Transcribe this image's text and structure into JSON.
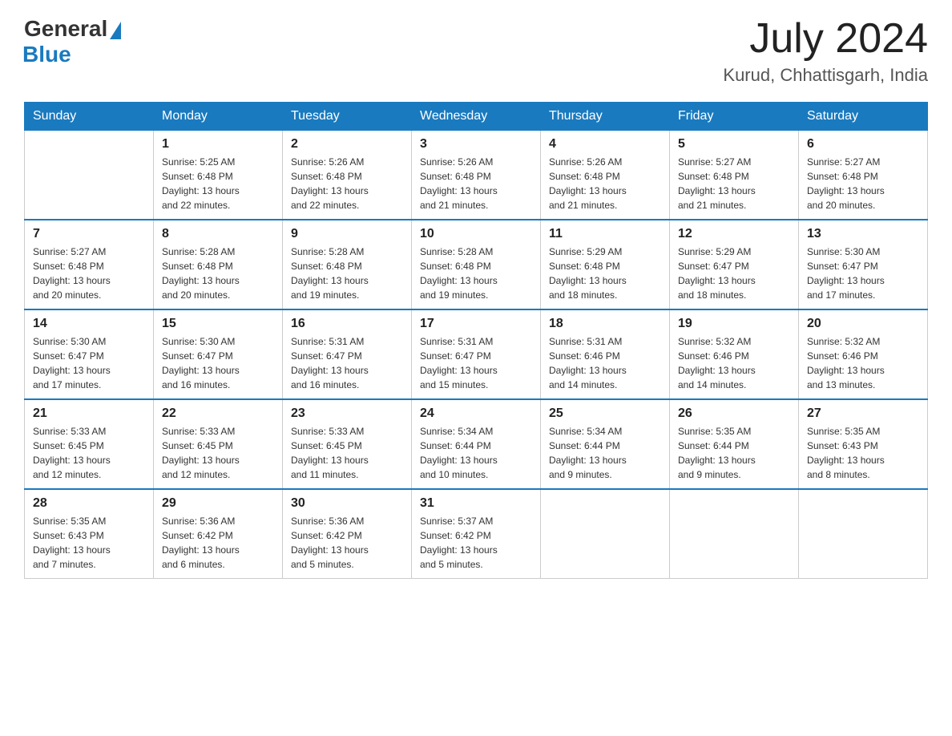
{
  "logo": {
    "general": "General",
    "blue": "Blue"
  },
  "title": {
    "month_year": "July 2024",
    "location": "Kurud, Chhattisgarh, India"
  },
  "header_days": [
    "Sunday",
    "Monday",
    "Tuesday",
    "Wednesday",
    "Thursday",
    "Friday",
    "Saturday"
  ],
  "weeks": [
    [
      {
        "day": "",
        "info": ""
      },
      {
        "day": "1",
        "info": "Sunrise: 5:25 AM\nSunset: 6:48 PM\nDaylight: 13 hours\nand 22 minutes."
      },
      {
        "day": "2",
        "info": "Sunrise: 5:26 AM\nSunset: 6:48 PM\nDaylight: 13 hours\nand 22 minutes."
      },
      {
        "day": "3",
        "info": "Sunrise: 5:26 AM\nSunset: 6:48 PM\nDaylight: 13 hours\nand 21 minutes."
      },
      {
        "day": "4",
        "info": "Sunrise: 5:26 AM\nSunset: 6:48 PM\nDaylight: 13 hours\nand 21 minutes."
      },
      {
        "day": "5",
        "info": "Sunrise: 5:27 AM\nSunset: 6:48 PM\nDaylight: 13 hours\nand 21 minutes."
      },
      {
        "day": "6",
        "info": "Sunrise: 5:27 AM\nSunset: 6:48 PM\nDaylight: 13 hours\nand 20 minutes."
      }
    ],
    [
      {
        "day": "7",
        "info": "Sunrise: 5:27 AM\nSunset: 6:48 PM\nDaylight: 13 hours\nand 20 minutes."
      },
      {
        "day": "8",
        "info": "Sunrise: 5:28 AM\nSunset: 6:48 PM\nDaylight: 13 hours\nand 20 minutes."
      },
      {
        "day": "9",
        "info": "Sunrise: 5:28 AM\nSunset: 6:48 PM\nDaylight: 13 hours\nand 19 minutes."
      },
      {
        "day": "10",
        "info": "Sunrise: 5:28 AM\nSunset: 6:48 PM\nDaylight: 13 hours\nand 19 minutes."
      },
      {
        "day": "11",
        "info": "Sunrise: 5:29 AM\nSunset: 6:48 PM\nDaylight: 13 hours\nand 18 minutes."
      },
      {
        "day": "12",
        "info": "Sunrise: 5:29 AM\nSunset: 6:47 PM\nDaylight: 13 hours\nand 18 minutes."
      },
      {
        "day": "13",
        "info": "Sunrise: 5:30 AM\nSunset: 6:47 PM\nDaylight: 13 hours\nand 17 minutes."
      }
    ],
    [
      {
        "day": "14",
        "info": "Sunrise: 5:30 AM\nSunset: 6:47 PM\nDaylight: 13 hours\nand 17 minutes."
      },
      {
        "day": "15",
        "info": "Sunrise: 5:30 AM\nSunset: 6:47 PM\nDaylight: 13 hours\nand 16 minutes."
      },
      {
        "day": "16",
        "info": "Sunrise: 5:31 AM\nSunset: 6:47 PM\nDaylight: 13 hours\nand 16 minutes."
      },
      {
        "day": "17",
        "info": "Sunrise: 5:31 AM\nSunset: 6:47 PM\nDaylight: 13 hours\nand 15 minutes."
      },
      {
        "day": "18",
        "info": "Sunrise: 5:31 AM\nSunset: 6:46 PM\nDaylight: 13 hours\nand 14 minutes."
      },
      {
        "day": "19",
        "info": "Sunrise: 5:32 AM\nSunset: 6:46 PM\nDaylight: 13 hours\nand 14 minutes."
      },
      {
        "day": "20",
        "info": "Sunrise: 5:32 AM\nSunset: 6:46 PM\nDaylight: 13 hours\nand 13 minutes."
      }
    ],
    [
      {
        "day": "21",
        "info": "Sunrise: 5:33 AM\nSunset: 6:45 PM\nDaylight: 13 hours\nand 12 minutes."
      },
      {
        "day": "22",
        "info": "Sunrise: 5:33 AM\nSunset: 6:45 PM\nDaylight: 13 hours\nand 12 minutes."
      },
      {
        "day": "23",
        "info": "Sunrise: 5:33 AM\nSunset: 6:45 PM\nDaylight: 13 hours\nand 11 minutes."
      },
      {
        "day": "24",
        "info": "Sunrise: 5:34 AM\nSunset: 6:44 PM\nDaylight: 13 hours\nand 10 minutes."
      },
      {
        "day": "25",
        "info": "Sunrise: 5:34 AM\nSunset: 6:44 PM\nDaylight: 13 hours\nand 9 minutes."
      },
      {
        "day": "26",
        "info": "Sunrise: 5:35 AM\nSunset: 6:44 PM\nDaylight: 13 hours\nand 9 minutes."
      },
      {
        "day": "27",
        "info": "Sunrise: 5:35 AM\nSunset: 6:43 PM\nDaylight: 13 hours\nand 8 minutes."
      }
    ],
    [
      {
        "day": "28",
        "info": "Sunrise: 5:35 AM\nSunset: 6:43 PM\nDaylight: 13 hours\nand 7 minutes."
      },
      {
        "day": "29",
        "info": "Sunrise: 5:36 AM\nSunset: 6:42 PM\nDaylight: 13 hours\nand 6 minutes."
      },
      {
        "day": "30",
        "info": "Sunrise: 5:36 AM\nSunset: 6:42 PM\nDaylight: 13 hours\nand 5 minutes."
      },
      {
        "day": "31",
        "info": "Sunrise: 5:37 AM\nSunset: 6:42 PM\nDaylight: 13 hours\nand 5 minutes."
      },
      {
        "day": "",
        "info": ""
      },
      {
        "day": "",
        "info": ""
      },
      {
        "day": "",
        "info": ""
      }
    ]
  ]
}
